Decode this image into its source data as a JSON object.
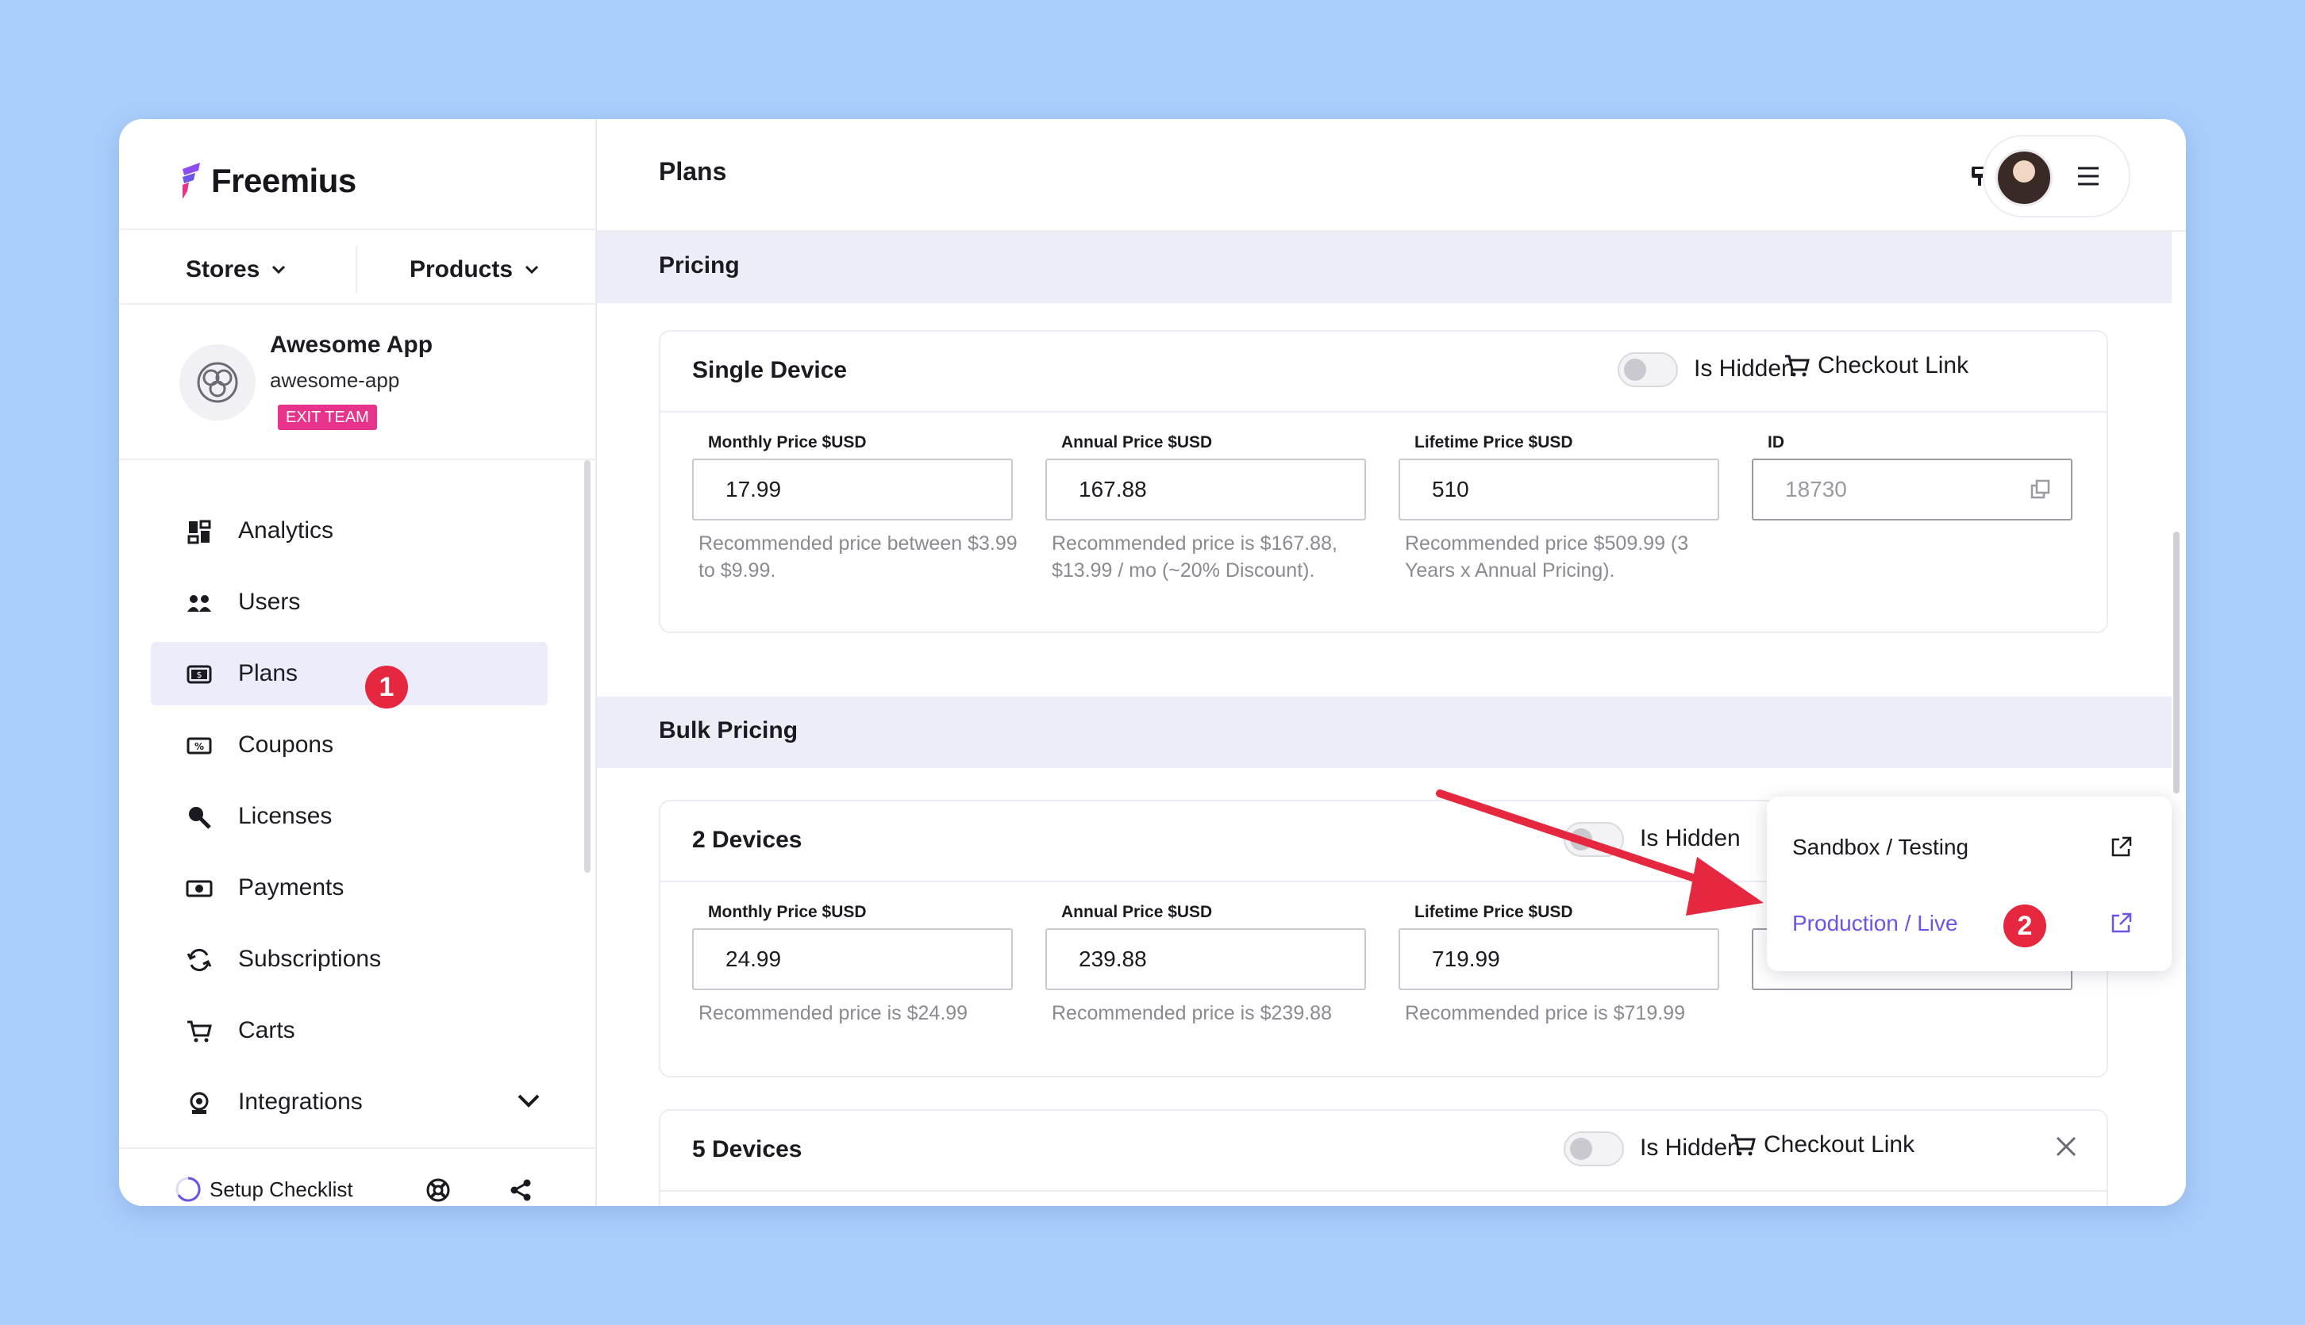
{
  "brand": {
    "name": "Freemius"
  },
  "sidebar": {
    "stores_label": "Stores",
    "products_label": "Products",
    "app": {
      "name": "Awesome App",
      "slug": "awesome-app",
      "badge": "EXIT TEAM"
    },
    "items": [
      {
        "label": "Analytics",
        "icon": "analytics-icon"
      },
      {
        "label": "Users",
        "icon": "users-icon"
      },
      {
        "label": "Plans",
        "icon": "plans-icon",
        "active": true
      },
      {
        "label": "Coupons",
        "icon": "coupons-icon"
      },
      {
        "label": "Licenses",
        "icon": "licenses-icon"
      },
      {
        "label": "Payments",
        "icon": "payments-icon"
      },
      {
        "label": "Subscriptions",
        "icon": "subscriptions-icon"
      },
      {
        "label": "Carts",
        "icon": "carts-icon"
      },
      {
        "label": "Integrations",
        "icon": "integrations-icon"
      }
    ],
    "footer": {
      "setup_label": "Setup Checklist"
    }
  },
  "header": {
    "title": "Plans"
  },
  "pricing": {
    "section_title": "Pricing",
    "card": {
      "title": "Single Device",
      "hidden_label": "Is Hidden",
      "checkout_label": "Checkout Link",
      "fields": [
        {
          "label": "Monthly Price $USD",
          "value": "17.99",
          "hint": "Recommended price between $3.99 to $9.99."
        },
        {
          "label": "Annual Price $USD",
          "value": "167.88",
          "hint": "Recommended price is $167.88, $13.99 / mo (~20% Discount)."
        },
        {
          "label": "Lifetime Price $USD",
          "value": "510",
          "hint": "Recommended price $509.99 (3 Years x Annual Pricing)."
        },
        {
          "label": "ID",
          "value": "18730"
        }
      ]
    }
  },
  "bulk": {
    "section_title": "Bulk Pricing",
    "card1": {
      "title": "2 Devices",
      "hidden_label": "Is Hidden",
      "fields": [
        {
          "label": "Monthly Price $USD",
          "value": "24.99",
          "hint": "Recommended price is $24.99"
        },
        {
          "label": "Annual Price $USD",
          "value": "239.88",
          "hint": "Recommended price is $239.88"
        },
        {
          "label": "Lifetime Price $USD",
          "value": "719.99",
          "hint": "Recommended price is $719.99"
        }
      ]
    },
    "card2": {
      "title": "5 Devices",
      "hidden_label": "Is Hidden",
      "checkout_label": "Checkout Link"
    }
  },
  "checkout_menu": {
    "items": [
      "Sandbox / Testing",
      "Production / Live"
    ]
  },
  "annotations": {
    "step1": "1",
    "step2": "2",
    "marker_color": "#e5283f"
  },
  "colors": {
    "accent": "#6a55e8",
    "badge": "#e8338c",
    "section_bg": "#ededf8",
    "background": "#aacefc"
  }
}
